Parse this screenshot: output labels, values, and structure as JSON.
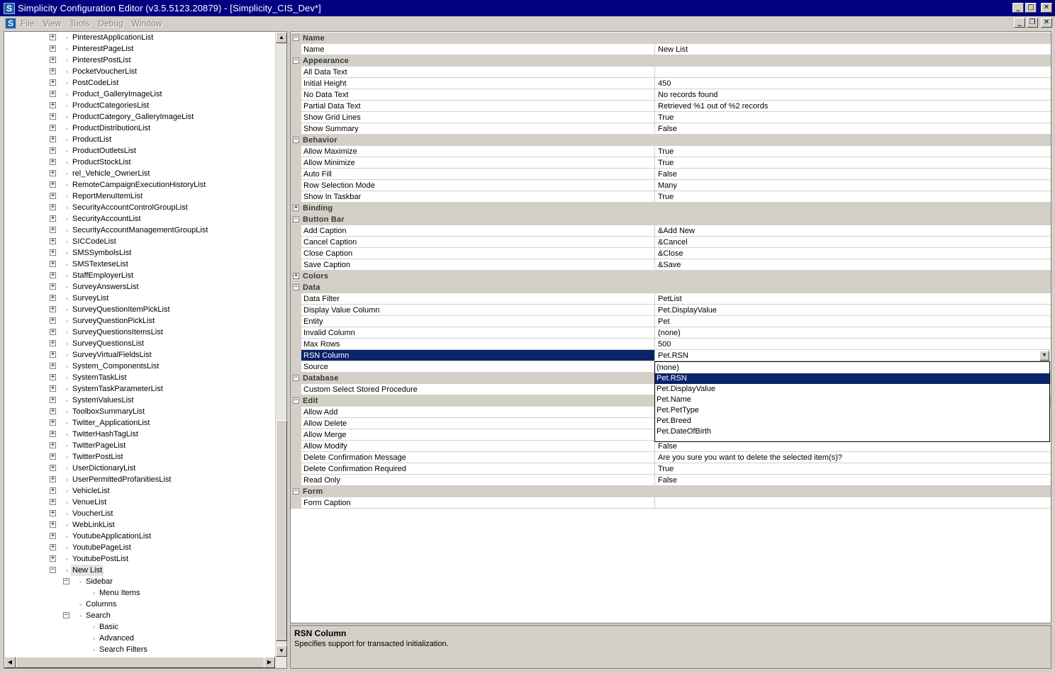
{
  "window": {
    "title": "Simplicity Configuration Editor (v3.5.5123.20879) - [Simplicity_CIS_Dev*]",
    "app_icon_letter": "S",
    "buttons": [
      "_",
      "□",
      "✕"
    ]
  },
  "menu": {
    "items": [
      "File",
      "View",
      "Tools",
      "Debug",
      "Window"
    ],
    "mdi_buttons": [
      "_",
      "❐",
      "✕"
    ]
  },
  "tree": {
    "items": [
      {
        "label": "PinterestApplicationList",
        "expander": "+"
      },
      {
        "label": "PinterestPageList",
        "expander": "+"
      },
      {
        "label": "PinterestPostList",
        "expander": "+"
      },
      {
        "label": "PocketVoucherList",
        "expander": "+"
      },
      {
        "label": "PostCodeList",
        "expander": "+"
      },
      {
        "label": "Product_GalleryImageList",
        "expander": "+"
      },
      {
        "label": "ProductCategoriesList",
        "expander": "+"
      },
      {
        "label": "ProductCategory_GalleryImageList",
        "expander": "+"
      },
      {
        "label": "ProductDistributionList",
        "expander": "+"
      },
      {
        "label": "ProductList",
        "expander": "+"
      },
      {
        "label": "ProductOutletsList",
        "expander": "+"
      },
      {
        "label": "ProductStockList",
        "expander": "+"
      },
      {
        "label": "rel_Vehicle_OwnerList",
        "expander": "+"
      },
      {
        "label": "RemoteCampaignExecutionHistoryList",
        "expander": "+"
      },
      {
        "label": "ReportMenuItemList",
        "expander": "+"
      },
      {
        "label": "SecurityAccountControlGroupList",
        "expander": "+"
      },
      {
        "label": "SecurityAccountList",
        "expander": "+"
      },
      {
        "label": "SecurityAccountManagementGroupList",
        "expander": "+"
      },
      {
        "label": "SICCodeList",
        "expander": "+"
      },
      {
        "label": "SMSSymbolsList",
        "expander": "+"
      },
      {
        "label": "SMSTexteseList",
        "expander": "+"
      },
      {
        "label": "StaffEmployerList",
        "expander": "+"
      },
      {
        "label": "SurveyAnswersList",
        "expander": "+"
      },
      {
        "label": "SurveyList",
        "expander": "+"
      },
      {
        "label": "SurveyQuestionItemPickList",
        "expander": "+"
      },
      {
        "label": "SurveyQuestionPickList",
        "expander": "+"
      },
      {
        "label": "SurveyQuestionsItemsList",
        "expander": "+"
      },
      {
        "label": "SurveyQuestionsList",
        "expander": "+"
      },
      {
        "label": "SurveyVirtualFieldsList",
        "expander": "+"
      },
      {
        "label": "System_ComponentsList",
        "expander": "+"
      },
      {
        "label": "SystemTaskList",
        "expander": "+"
      },
      {
        "label": "SystemTaskParameterList",
        "expander": "+"
      },
      {
        "label": "SystemValuesList",
        "expander": "+"
      },
      {
        "label": "ToolboxSummaryList",
        "expander": "+"
      },
      {
        "label": "Twitter_ApplicationList",
        "expander": "+"
      },
      {
        "label": "TwitterHashTagList",
        "expander": "+"
      },
      {
        "label": "TwitterPageList",
        "expander": "+"
      },
      {
        "label": "TwitterPostList",
        "expander": "+"
      },
      {
        "label": "UserDictionaryList",
        "expander": "+"
      },
      {
        "label": "UserPermittedProfanitiesList",
        "expander": "+"
      },
      {
        "label": "VehicleList",
        "expander": "+"
      },
      {
        "label": "VenueList",
        "expander": "+"
      },
      {
        "label": "VoucherList",
        "expander": "+"
      },
      {
        "label": "WebLinkList",
        "expander": "+"
      },
      {
        "label": "YoutubeApplicationList",
        "expander": "+"
      },
      {
        "label": "YoutubePageList",
        "expander": "+"
      },
      {
        "label": "YoutubePostList",
        "expander": "+"
      },
      {
        "label": "New List",
        "expander": "−",
        "selected": true
      },
      {
        "label": "Sidebar",
        "expander": "−",
        "level": 1
      },
      {
        "label": "Menu Items",
        "level": 2
      },
      {
        "label": "Columns",
        "level": 1
      },
      {
        "label": "Search",
        "expander": "−",
        "level": 1
      },
      {
        "label": "Basic",
        "level": 2
      },
      {
        "label": "Advanced",
        "level": 2
      },
      {
        "label": "Search Filters",
        "level": 2
      }
    ]
  },
  "grid": {
    "rows": [
      {
        "type": "cat",
        "name": "Name",
        "expander": "−"
      },
      {
        "type": "item",
        "name": "Name",
        "value": "New List"
      },
      {
        "type": "cat",
        "name": "Appearance",
        "expander": "−"
      },
      {
        "type": "item",
        "name": "All Data Text",
        "value": ""
      },
      {
        "type": "item",
        "name": "Initial Height",
        "value": "450"
      },
      {
        "type": "item",
        "name": "No Data Text",
        "value": "No records found"
      },
      {
        "type": "item",
        "name": "Partial Data Text",
        "value": "Retrieved %1 out of %2 records"
      },
      {
        "type": "item",
        "name": "Show Grid Lines",
        "value": "True"
      },
      {
        "type": "item",
        "name": "Show Summary",
        "value": "False"
      },
      {
        "type": "cat",
        "name": "Behavior",
        "expander": "−"
      },
      {
        "type": "item",
        "name": "Allow Maximize",
        "value": "True"
      },
      {
        "type": "item",
        "name": "Allow Minimize",
        "value": "True"
      },
      {
        "type": "item",
        "name": "Auto Fill",
        "value": "False"
      },
      {
        "type": "item",
        "name": "Row Selection Mode",
        "value": "Many"
      },
      {
        "type": "item",
        "name": "Show In Taskbar",
        "value": "True"
      },
      {
        "type": "cat",
        "name": "Binding",
        "expander": "+"
      },
      {
        "type": "cat",
        "name": "Button Bar",
        "expander": "−"
      },
      {
        "type": "item",
        "name": "Add Caption",
        "value": "&Add New"
      },
      {
        "type": "item",
        "name": "Cancel Caption",
        "value": "&Cancel"
      },
      {
        "type": "item",
        "name": "Close Caption",
        "value": "&Close"
      },
      {
        "type": "item",
        "name": "Save Caption",
        "value": "&Save"
      },
      {
        "type": "cat",
        "name": "Colors",
        "expander": "+"
      },
      {
        "type": "cat",
        "name": "Data",
        "expander": "−"
      },
      {
        "type": "item",
        "name": "Data Filter",
        "value": "PetList"
      },
      {
        "type": "item",
        "name": "Display Value Column",
        "value": "Pet.DisplayValue"
      },
      {
        "type": "item",
        "name": "Entity",
        "value": "Pet"
      },
      {
        "type": "item",
        "name": "Invalid Column",
        "value": "(none)"
      },
      {
        "type": "item",
        "name": "Max Rows",
        "value": "500"
      },
      {
        "type": "item",
        "name": "RSN Column",
        "value": "Pet.RSN",
        "selected": true
      },
      {
        "type": "item",
        "name": "Source",
        "value": ""
      },
      {
        "type": "cat",
        "name": "Database",
        "expander": "−"
      },
      {
        "type": "item",
        "name": "Custom Select Stored Procedure",
        "value": ""
      },
      {
        "type": "cat",
        "name": "Edit",
        "expander": "−"
      },
      {
        "type": "item",
        "name": "Allow Add",
        "value": ""
      },
      {
        "type": "item",
        "name": "Allow Delete",
        "value": ""
      },
      {
        "type": "item",
        "name": "Allow Merge",
        "value": ""
      },
      {
        "type": "item",
        "name": "Allow Modify",
        "value": "False"
      },
      {
        "type": "item",
        "name": "Delete Confirmation Message",
        "value": "Are you sure you want to delete the selected item(s)?"
      },
      {
        "type": "item",
        "name": "Delete Confirmation Required",
        "value": "True"
      },
      {
        "type": "item",
        "name": "Read Only",
        "value": "False"
      },
      {
        "type": "cat",
        "name": "Form",
        "expander": "−"
      },
      {
        "type": "item",
        "name": "Form Caption",
        "value": ""
      }
    ],
    "dropdown": {
      "button_glyph": "▼",
      "options": [
        "(none)",
        "Pet.RSN",
        "Pet.DisplayValue",
        "Pet.Name",
        "Pet.PetType",
        "Pet.Breed",
        "Pet.DateOfBirth"
      ],
      "selected_index": 1
    }
  },
  "help": {
    "title": "RSN Column",
    "description": "Specifies support for transacted initialization."
  },
  "scroll": {
    "up": "▲",
    "down": "▼",
    "left": "◀",
    "right": "▶"
  }
}
